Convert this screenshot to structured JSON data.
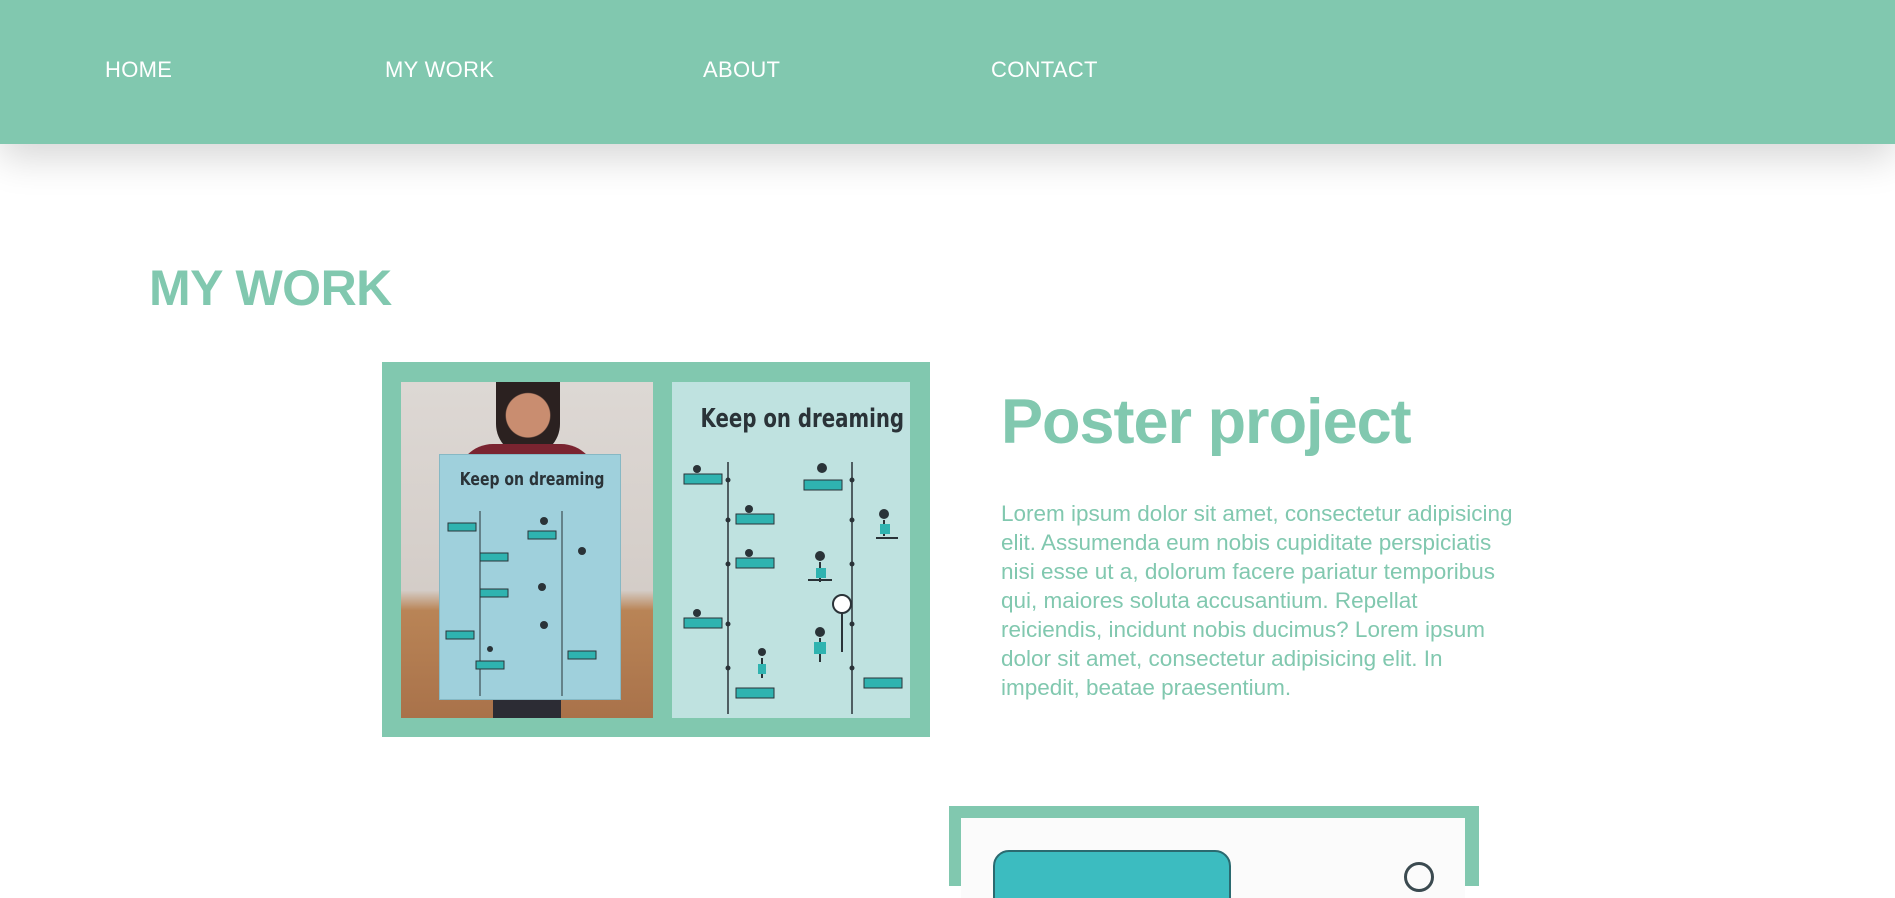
{
  "nav": {
    "items": [
      {
        "label": "HOME"
      },
      {
        "label": "MY WORK"
      },
      {
        "label": "ABOUT"
      },
      {
        "label": "CONTACT"
      }
    ]
  },
  "section": {
    "title": "MY WORK"
  },
  "projects": [
    {
      "title": "Poster project",
      "description": "Lorem ipsum dolor sit amet, consectetur adipisicing elit. Assumenda eum nobis cupiditate perspiciatis nisi esse ut a, dolorum facere pariatur temporibus qui, maiores soluta accusantium. Repellat reiciendis, incidunt nobis ducimus? Lorem ipsum dolor sit amet, consectetur adipisicing elit. In impedit, beatae praesentium.",
      "poster_heading": "Keep on dreaming"
    }
  ],
  "colors": {
    "accent": "#81c8af",
    "nav_text": "#ffffff",
    "background": "#ffffff",
    "poster_bg": "#bfe2e0",
    "teal": "#2fb3b0"
  }
}
